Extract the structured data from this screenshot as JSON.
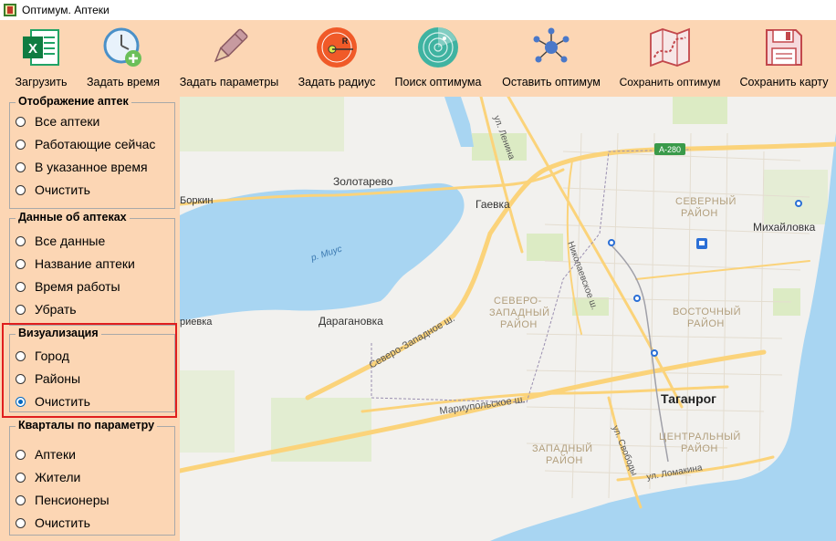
{
  "window": {
    "title": "Оптимум. Аптеки"
  },
  "toolbar": {
    "buttons": [
      {
        "label": "Загрузить",
        "icon": "excel-icon"
      },
      {
        "label": "Задать время",
        "icon": "clock-add-icon"
      },
      {
        "label": "Задать параметры",
        "icon": "pen-icon"
      },
      {
        "label": "Задать радиус",
        "icon": "radius-icon"
      },
      {
        "label": "Поиск оптимума",
        "icon": "radar-icon"
      },
      {
        "label": "Оставить оптимум",
        "icon": "network-icon"
      },
      {
        "label": "Сохранить оптимум",
        "icon": "map-route-icon"
      },
      {
        "label": "Сохранить карту",
        "icon": "floppy-disk-icon"
      }
    ]
  },
  "sidebar": {
    "pharmacy_display": {
      "title": "Отображение аптек",
      "options": [
        "Все аптеки",
        "Работающие сейчас",
        "В указанное время",
        "Очистить"
      ],
      "selected": ""
    },
    "pharmacy_data": {
      "title": "Данные об аптеках",
      "options": [
        "Все данные",
        "Название аптеки",
        "Время работы",
        "Убрать"
      ],
      "selected": ""
    },
    "visualization": {
      "title": "Визуализация",
      "options": [
        "Город",
        "Районы",
        "Очистить"
      ],
      "selected": "Очистить"
    },
    "blocks_by_param": {
      "title": "Кварталы по параметру",
      "options": [
        "Аптеки",
        "Жители",
        "Пенсионеры",
        "Очистить"
      ],
      "selected": ""
    }
  },
  "map": {
    "labels": {
      "zolotarevo": "Золотарево",
      "borkin": "Боркин",
      "gaevka": "Гаевка",
      "lenina": "ул. Ленина",
      "a280": "А-280",
      "severny": [
        "СЕВЕРНЫЙ",
        "РАЙОН"
      ],
      "mikhailovka": "Михайловка",
      "mius": "р. Миус",
      "nikolaevskoe": "Николаевское ш.",
      "severo_zapadny_district": [
        "СЕВЕРО-",
        "ЗАПАДНЫЙ",
        "РАЙОН"
      ],
      "vostochny": [
        "ВОСТОЧНЫЙ",
        "РАЙОН"
      ],
      "ievka": "риевка",
      "daraganovka": "Дарагановка",
      "severo_zapadnoe_sh": "Северо-Западное ш.",
      "taganrog": "Таганрог",
      "mariupolskoe": "Мариупольское ш.",
      "tsentralny": [
        "ЦЕНТРАЛЬНЫЙ",
        "РАЙОН"
      ],
      "zapadny": [
        "ЗАПАДНЫЙ",
        "РАЙОН"
      ],
      "svobody": "ул. Свободы",
      "lomakina": "ул. Ломакина"
    },
    "colors": {
      "water": "#a8d5f2",
      "land": "#f2f1ee",
      "green": "#dcebc4",
      "road": "#fbd37a"
    }
  }
}
